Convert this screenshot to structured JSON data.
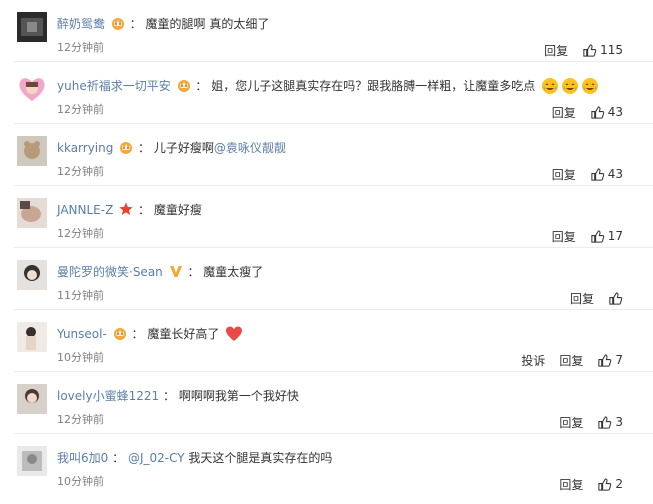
{
  "labels": {
    "reply": "回复",
    "report": "投诉"
  },
  "colors": {
    "username": "#5a7ea8",
    "meta": "#808080",
    "badge": "#f3a838",
    "heart": "#e84a4a"
  },
  "comments": [
    {
      "user": "醉奶鸳鸯",
      "badge": "crown-badge",
      "colon": "：",
      "text": "魔童的腿啊 真的太细了",
      "time": "12分钟前",
      "likes": "115"
    },
    {
      "user": "yuhe祈福求一切平安",
      "badge": "crown-badge",
      "colon": "：",
      "text": "姐，您儿子这腿真实存在吗？跟我胳膊一样粗，让魔童多吃点",
      "emoji": [
        "laughing-crying-emoji",
        "laughing-crying-emoji",
        "laughing-crying-emoji"
      ],
      "time": "12分钟前",
      "likes": "43"
    },
    {
      "user": "kkarrying",
      "badge": "crown-badge",
      "colon": "：",
      "text": "儿子好瘦啊",
      "mention": "@袁咏仪靓靓",
      "time": "12分钟前",
      "likes": "43"
    },
    {
      "user": "JANNLE-Z",
      "badge": "star-badge",
      "colon": "：",
      "text": "魔童好瘦",
      "time": "12分钟前",
      "likes": "17"
    },
    {
      "user": "曼陀罗的微笑·Sean",
      "badge": "v-badge",
      "colon": "：",
      "text": "魔童太瘦了",
      "time": "11分钟前",
      "likes": ""
    },
    {
      "user": "Yunseol-",
      "badge": "crown-badge",
      "colon": "：",
      "text": "魔童长好高了",
      "heart": true,
      "time": "10分钟前",
      "likes": "7",
      "report": true
    },
    {
      "user": "lovely小蜜蜂1221",
      "colon": "：",
      "text": "啊啊啊我第一个我好快",
      "time": "12分钟前",
      "likes": "3"
    },
    {
      "user": "我叫6加0",
      "colon": "：",
      "mention_first": "@J_02-CY",
      "text": " 我天这个腿是真实存在的吗",
      "time": "10分钟前",
      "likes": "2"
    }
  ]
}
